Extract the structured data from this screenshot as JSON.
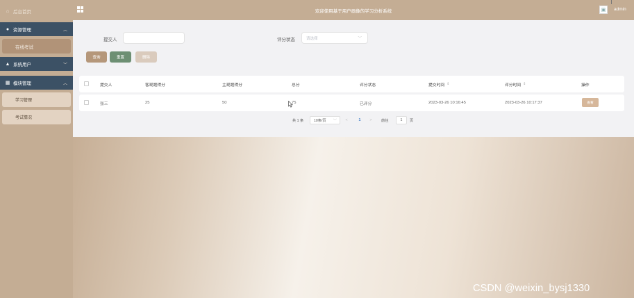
{
  "sidebar": {
    "home": "后台首页",
    "resources": "资源管理",
    "online_exam": "在线考试",
    "system_users": "系统用户",
    "modules": "模块管理",
    "study_mgmt": "学习管理",
    "exam_status": "考试情况"
  },
  "header": {
    "title": "欢迎使用基于用户画像的学习分析系统",
    "user": "admin"
  },
  "search": {
    "submitter_label": "提交人",
    "submitter_value": "",
    "status_label": "评分状态",
    "status_placeholder": "请选择"
  },
  "buttons": {
    "query": "查询",
    "reset": "重置",
    "delete": "删除"
  },
  "table": {
    "columns": [
      "提交人",
      "客观题得分",
      "主观题得分",
      "总分",
      "评分状态",
      "提交时间",
      "评分时间",
      "操作"
    ],
    "rows": [
      {
        "submitter": "张三",
        "objective": "25",
        "subjective": "50",
        "total": "75",
        "status": "已评分",
        "submit_time": "2023-03-26 10:16:45",
        "score_time": "2023-03-26 10:17:37",
        "action": "查看"
      }
    ]
  },
  "pagination": {
    "total": "共 1 条",
    "page_size": "10条/页",
    "prev": "<",
    "current": "1",
    "next": ">",
    "goto": "前往",
    "goto_value": "1",
    "page_suffix": "页"
  },
  "watermark": "CSDN @weixin_bysj1330",
  "colors": {
    "sidebar_bg": "#c4ad94",
    "menu_dark": "#3c5165",
    "query_button": "#b5977a",
    "reset_button": "#6d8f73",
    "delete_button": "#dacbbd"
  }
}
